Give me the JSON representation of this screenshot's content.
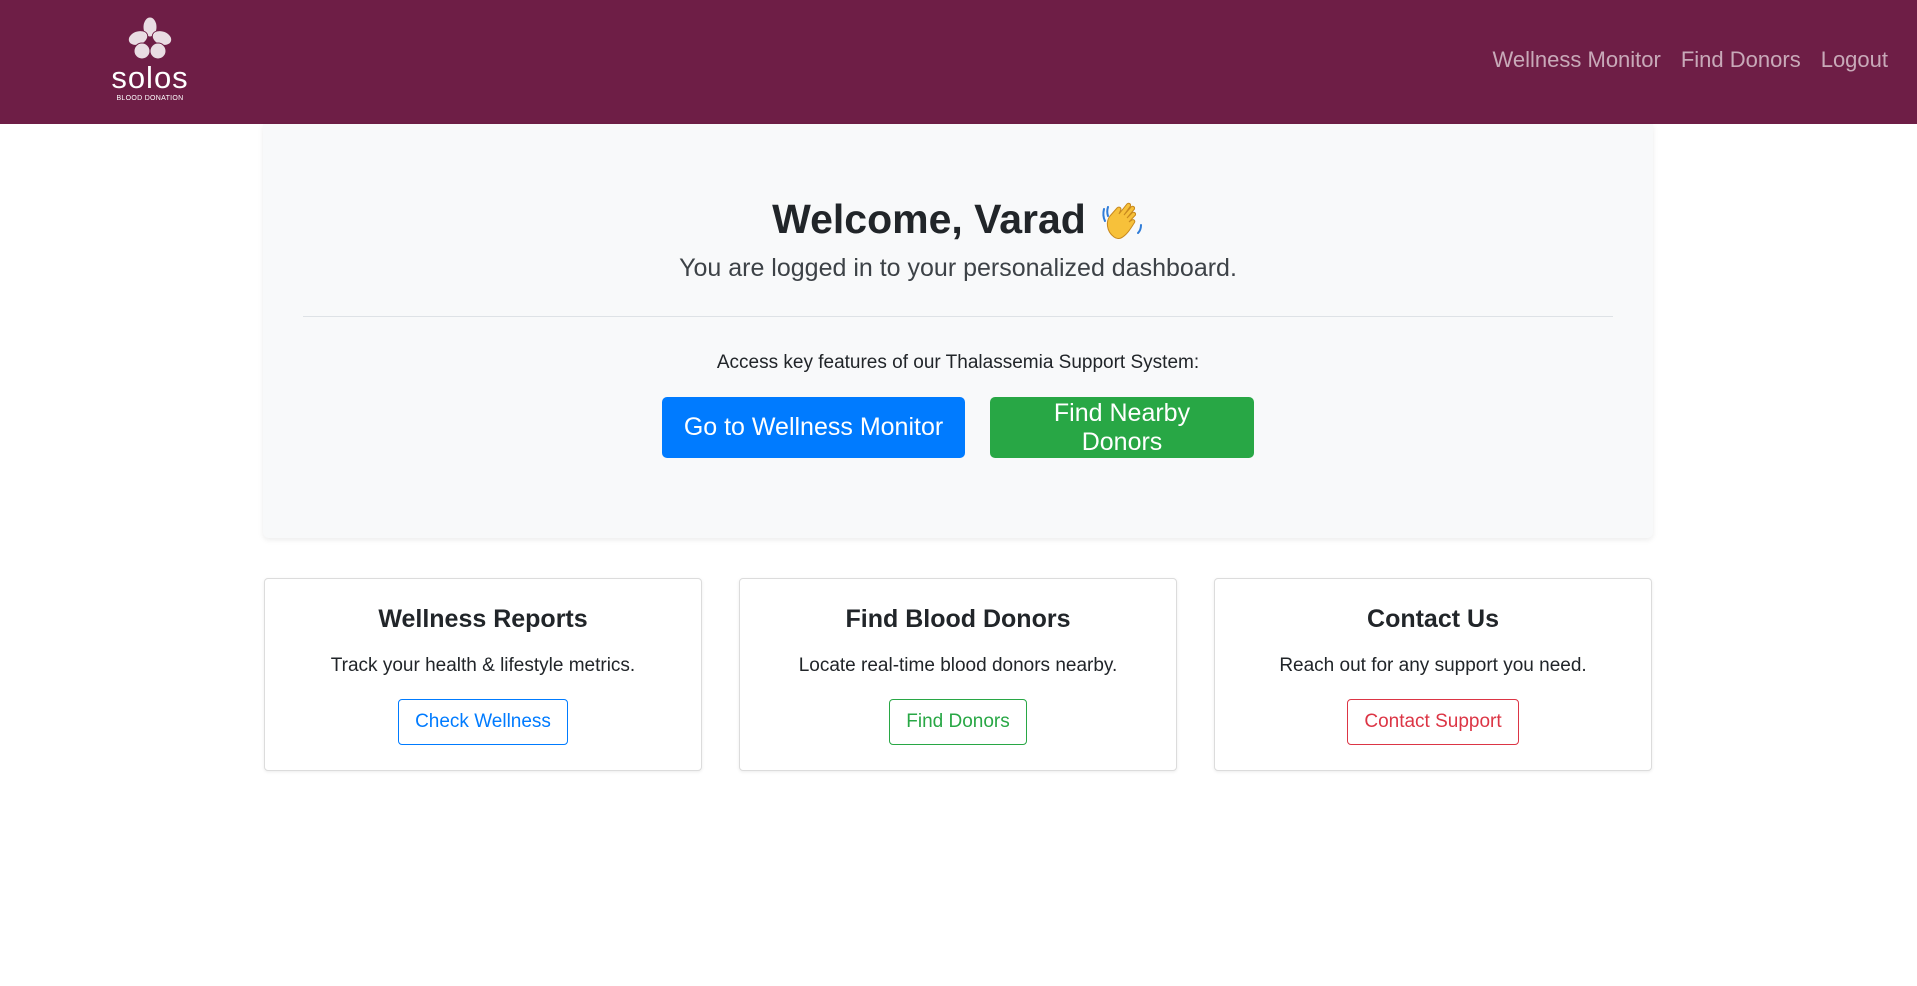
{
  "navbar": {
    "brand_name": "solos",
    "brand_tagline": "BLOOD DONATION",
    "links": [
      {
        "label": "Wellness Monitor"
      },
      {
        "label": "Find Donors"
      },
      {
        "label": "Logout"
      }
    ],
    "background_color": "#6e1e46"
  },
  "hero": {
    "welcome": "Welcome, Varad",
    "wave_icon": "waving-hand-icon",
    "lead": "You are logged in to your personalized dashboard.",
    "access_text": "Access key features of our Thalassemia Support System:",
    "primary_button": "Go to Wellness Monitor",
    "success_button": "Find Nearby Donors"
  },
  "cards": [
    {
      "title": "Wellness Reports",
      "text": "Track your health & lifestyle metrics.",
      "button": "Check Wellness",
      "color": "#007bff"
    },
    {
      "title": "Find Blood Donors",
      "text": "Locate real-time blood donors nearby.",
      "button": "Find Donors",
      "color": "#28a745"
    },
    {
      "title": "Contact Us",
      "text": "Reach out for any support you need.",
      "button": "Contact Support",
      "color": "#dc3545"
    }
  ]
}
